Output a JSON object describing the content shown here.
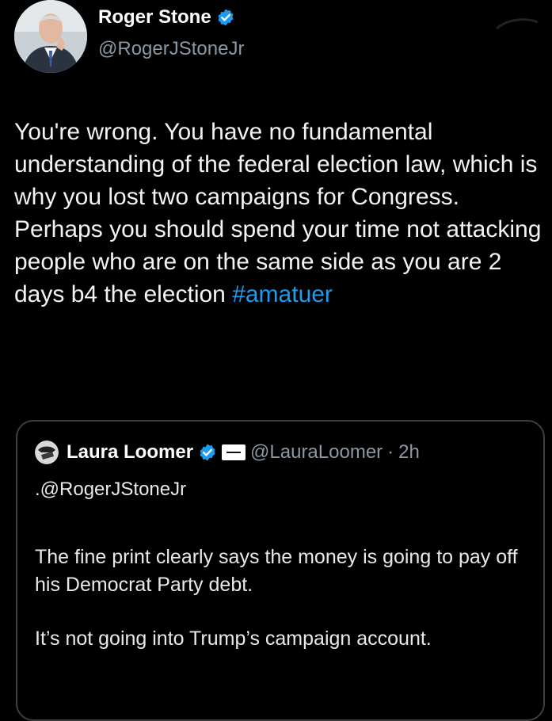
{
  "tweet": {
    "author_name": "Roger Stone",
    "author_handle": "@RogerJStoneJr",
    "text_before_hashtag": "You're wrong. You have no fundamental understanding of the federal election law, which is why you lost two campaigns for Congress. Perhaps you should spend your time not attacking people who are on the same side as you are 2 days b4 the election ",
    "hashtag": "#amatuer"
  },
  "quoted_tweet": {
    "author_name": "Laura Loomer",
    "author_handle": "@LauraLoomer",
    "separator": "·",
    "timestamp": "2h",
    "reply_to": ".@RogerJStoneJr",
    "paragraph_1": "The fine print clearly says the money is going to pay off his Democrat Party debt.",
    "paragraph_2": "It’s not going into Trump’s campaign account."
  },
  "colors": {
    "background": "#000000",
    "text": "#e7e9ea",
    "secondary_text": "#8b98a5",
    "link": "#1d9bf0",
    "verified_badge": "#1d9bf0",
    "card_border": "#3a3f44"
  },
  "icons": {
    "verified": "verified-badge-icon",
    "affiliate": "affiliation-badge-icon"
  }
}
